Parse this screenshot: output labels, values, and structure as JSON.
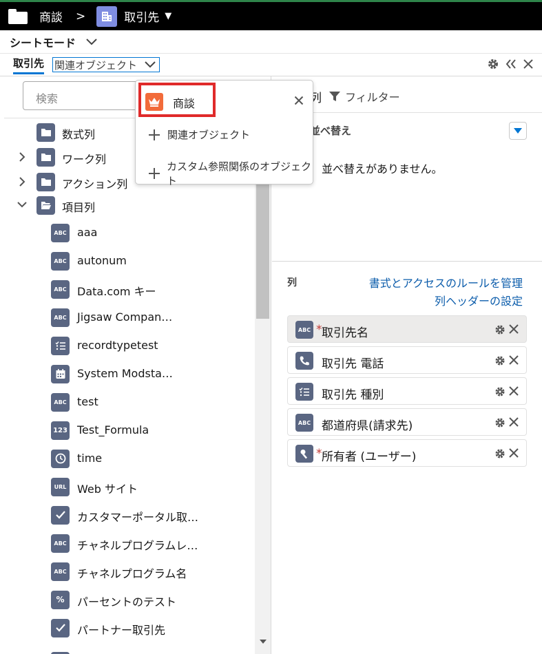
{
  "topbar": {
    "breadcrumb_root": "商談",
    "separator": ">",
    "object_title": "取引先"
  },
  "mode": {
    "label": "シートモード"
  },
  "tabs": {
    "main": "取引先",
    "related": "関連オブジェクト"
  },
  "search": {
    "placeholder": "検索"
  },
  "tree": [
    {
      "label": "数式列",
      "kind": "folder",
      "expandable": false
    },
    {
      "label": "ワーク列",
      "kind": "folder",
      "expandable": true
    },
    {
      "label": "アクション列",
      "kind": "folder",
      "expandable": true
    },
    {
      "label": "項目列",
      "kind": "folder-open",
      "expandable": true,
      "expanded": true
    },
    {
      "label": "aaa",
      "icon": "ABC"
    },
    {
      "label": "autonum",
      "icon": "ABC"
    },
    {
      "label": "Data.com キー",
      "icon": "ABC"
    },
    {
      "label": "Jigsaw Compan…",
      "icon": "ABC"
    },
    {
      "label": "recordtypetest",
      "icon": "picklist"
    },
    {
      "label": "System Modsta…",
      "icon": "calendar"
    },
    {
      "label": "test",
      "icon": "ABC"
    },
    {
      "label": "Test_Formula",
      "icon": "123"
    },
    {
      "label": "time",
      "icon": "clock"
    },
    {
      "label": "Web サイト",
      "icon": "URL"
    },
    {
      "label": "カスタマーポータル取…",
      "icon": "check"
    },
    {
      "label": "チャネルプログラムレ…",
      "icon": "ABC"
    },
    {
      "label": "チャネルプログラム名",
      "icon": "ABC"
    },
    {
      "label": "パーセントのテスト",
      "icon": "%"
    },
    {
      "label": "パートナー取引先",
      "icon": "check"
    }
  ],
  "right": {
    "tab_active": "列",
    "tab_filter": "フィルター",
    "sort_title": "並べ替え",
    "no_sort": "並べ替えがありません。",
    "columns_title": "列",
    "link_rules": "書式とアクセスのルールを管理",
    "link_header": "列ヘッダーの設定",
    "columns": [
      {
        "label": "取引先名",
        "required": true,
        "icon": "ABC",
        "selected": true
      },
      {
        "label": "取引先 電話",
        "required": false,
        "icon": "phone"
      },
      {
        "label": "取引先 種別",
        "required": false,
        "icon": "picklist"
      },
      {
        "label": "都道府県(請求先)",
        "required": false,
        "icon": "ABC"
      },
      {
        "label": "所有者 (ユーザー)",
        "required": true,
        "icon": "lookup"
      }
    ]
  },
  "popover": {
    "main_item": "商談",
    "items": [
      "関連オブジェクト",
      "カスタム参照関係のオブジェクト"
    ]
  }
}
